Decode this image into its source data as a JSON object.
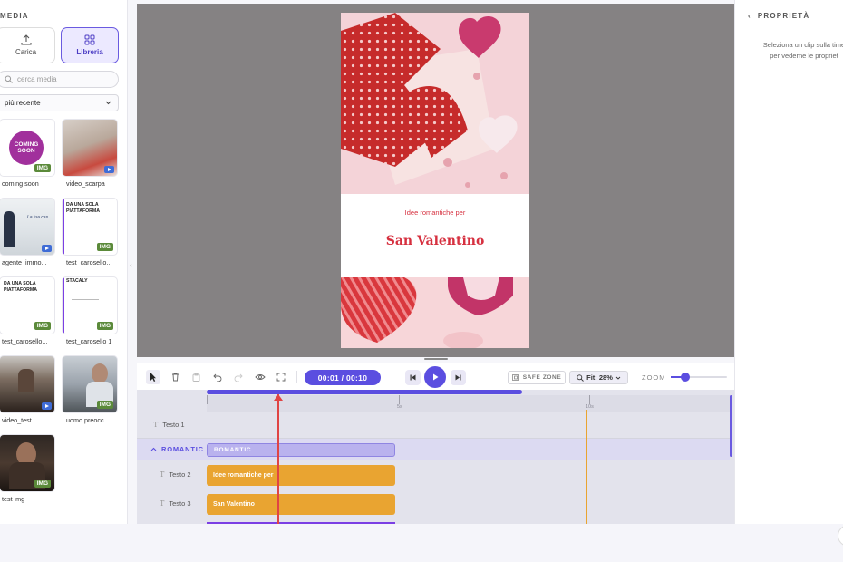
{
  "left_panel": {
    "title": "MEDIA",
    "upload_label": "Carica",
    "library_label": "Libreria",
    "search_placeholder": "cerca media",
    "sort_value": "più recente",
    "items": [
      {
        "label": "coming soon",
        "badge": "IMG",
        "thumb_text": "COMING SOON"
      },
      {
        "label": "video_scarpa",
        "badge": "video"
      },
      {
        "label": "agente_immo...",
        "badge": "video",
        "thumb_text": "La tua cas"
      },
      {
        "label": "test_carosello...",
        "badge": "IMG",
        "thumb_text": "DA UNA SOLA PIATTAFORMA"
      },
      {
        "label": "test_carosello...",
        "badge": "IMG",
        "thumb_text": "DA UNA SOLA PIATTAFORMA"
      },
      {
        "label": "test_carosello 1",
        "badge": "IMG",
        "thumb_text": "STACALY"
      },
      {
        "label": "video_test",
        "badge": "video"
      },
      {
        "label": "uomo preocc...",
        "badge": "IMG"
      },
      {
        "label": "test img",
        "badge": "IMG"
      }
    ]
  },
  "preview": {
    "subtitle": "Idee romantiche per",
    "title": "San Valentino"
  },
  "toolbar": {
    "time": "00:01 / 00:10",
    "safe_zone": "SAFE ZONE",
    "fit": "Fit: 28%",
    "zoom_label": "ZOOM",
    "zoom_level": 0.25,
    "colors": {
      "accent": "#5b4ee0"
    }
  },
  "timeline": {
    "ticks": [
      "5s",
      "10s"
    ],
    "rows": [
      {
        "label": "Testo 1",
        "clip": ""
      },
      {
        "label": "ROMANTIC",
        "clip": "ROMANTIC"
      },
      {
        "label": "Testo 2",
        "clip": "Idee romantiche per"
      },
      {
        "label": "Testo 3",
        "clip": "San Valentino"
      }
    ],
    "colors": {
      "group": "#b9b2ee",
      "text_clip": "#e9a431",
      "playhead": "#e04444"
    }
  },
  "right_panel": {
    "title": "PROPRIETÀ",
    "message_line1": "Seleziona un clip sulla time",
    "message_line2": "per vederne le propriet"
  }
}
